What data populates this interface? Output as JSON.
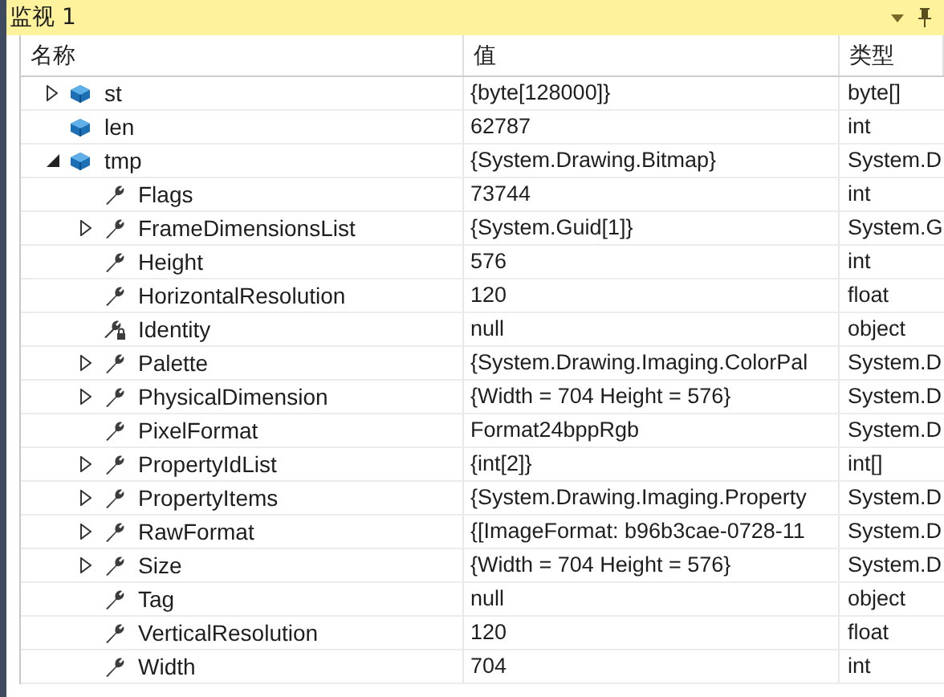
{
  "window": {
    "title": "监视 1"
  },
  "table": {
    "columns": [
      "名称",
      "值",
      "类型"
    ],
    "rows": [
      {
        "name": "st",
        "value": "{byte[128000]}",
        "type": "byte[]",
        "kind": "variable",
        "expandable": true,
        "expanded": false
      },
      {
        "name": "len",
        "value": "62787",
        "type": "int",
        "kind": "variable",
        "expandable": false
      },
      {
        "name": "tmp",
        "value": "{System.Drawing.Bitmap}",
        "type": "System.D",
        "kind": "variable",
        "expandable": true,
        "expanded": true,
        "children": [
          {
            "name": "Flags",
            "value": "73744",
            "type": "int",
            "kind": "property",
            "expandable": false
          },
          {
            "name": "FrameDimensionsList",
            "value": "{System.Guid[1]}",
            "type": "System.G",
            "kind": "property",
            "expandable": true,
            "expanded": false
          },
          {
            "name": "Height",
            "value": "576",
            "type": "int",
            "kind": "property",
            "expandable": false
          },
          {
            "name": "HorizontalResolution",
            "value": "120",
            "type": "float",
            "kind": "property",
            "expandable": false
          },
          {
            "name": "Identity",
            "value": "null",
            "type": "object",
            "kind": "private-property",
            "expandable": false
          },
          {
            "name": "Palette",
            "value": "{System.Drawing.Imaging.ColorPal",
            "type": "System.D",
            "kind": "property",
            "expandable": true,
            "expanded": false
          },
          {
            "name": "PhysicalDimension",
            "value": "{Width = 704 Height = 576}",
            "type": "System.D",
            "kind": "property",
            "expandable": true,
            "expanded": false
          },
          {
            "name": "PixelFormat",
            "value": "Format24bppRgb",
            "type": "System.D",
            "kind": "property",
            "expandable": false
          },
          {
            "name": "PropertyIdList",
            "value": "{int[2]}",
            "type": "int[]",
            "kind": "property",
            "expandable": true,
            "expanded": false
          },
          {
            "name": "PropertyItems",
            "value": "{System.Drawing.Imaging.Property",
            "type": "System.D",
            "kind": "property",
            "expandable": true,
            "expanded": false
          },
          {
            "name": "RawFormat",
            "value": "{[ImageFormat: b96b3cae-0728-11",
            "type": "System.D",
            "kind": "property",
            "expandable": true,
            "expanded": false
          },
          {
            "name": "Size",
            "value": "{Width = 704 Height = 576}",
            "type": "System.D",
            "kind": "property",
            "expandable": true,
            "expanded": false
          },
          {
            "name": "Tag",
            "value": "null",
            "type": "object",
            "kind": "property",
            "expandable": false
          },
          {
            "name": "VerticalResolution",
            "value": "120",
            "type": "float",
            "kind": "property",
            "expandable": false
          },
          {
            "name": "Width",
            "value": "704",
            "type": "int",
            "kind": "property",
            "expandable": false
          }
        ]
      }
    ]
  }
}
